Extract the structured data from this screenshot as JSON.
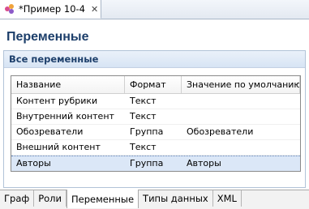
{
  "editor": {
    "tab_title": "*Пример 10-4",
    "app_icon": "palette-icon",
    "close_icon": "close-icon"
  },
  "page": {
    "title": "Переменные"
  },
  "section": {
    "title": "Все переменные"
  },
  "table": {
    "columns": [
      "Название",
      "Формат",
      "Значение по умолчанию"
    ],
    "rows": [
      [
        "Контент рубрики",
        "Текст",
        ""
      ],
      [
        "Внутренний контент",
        "Текст",
        ""
      ],
      [
        "Обозреватели",
        "Группа",
        "Обозреватели"
      ],
      [
        "Внешний контент",
        "Текст",
        ""
      ],
      [
        "Авторы",
        "Группа",
        "Авторы"
      ]
    ],
    "selected_row": 4
  },
  "bottom_tabs": [
    "Граф",
    "Роли",
    "Переменные",
    "Типы данных",
    "XML"
  ],
  "active_tab": "Переменные"
}
